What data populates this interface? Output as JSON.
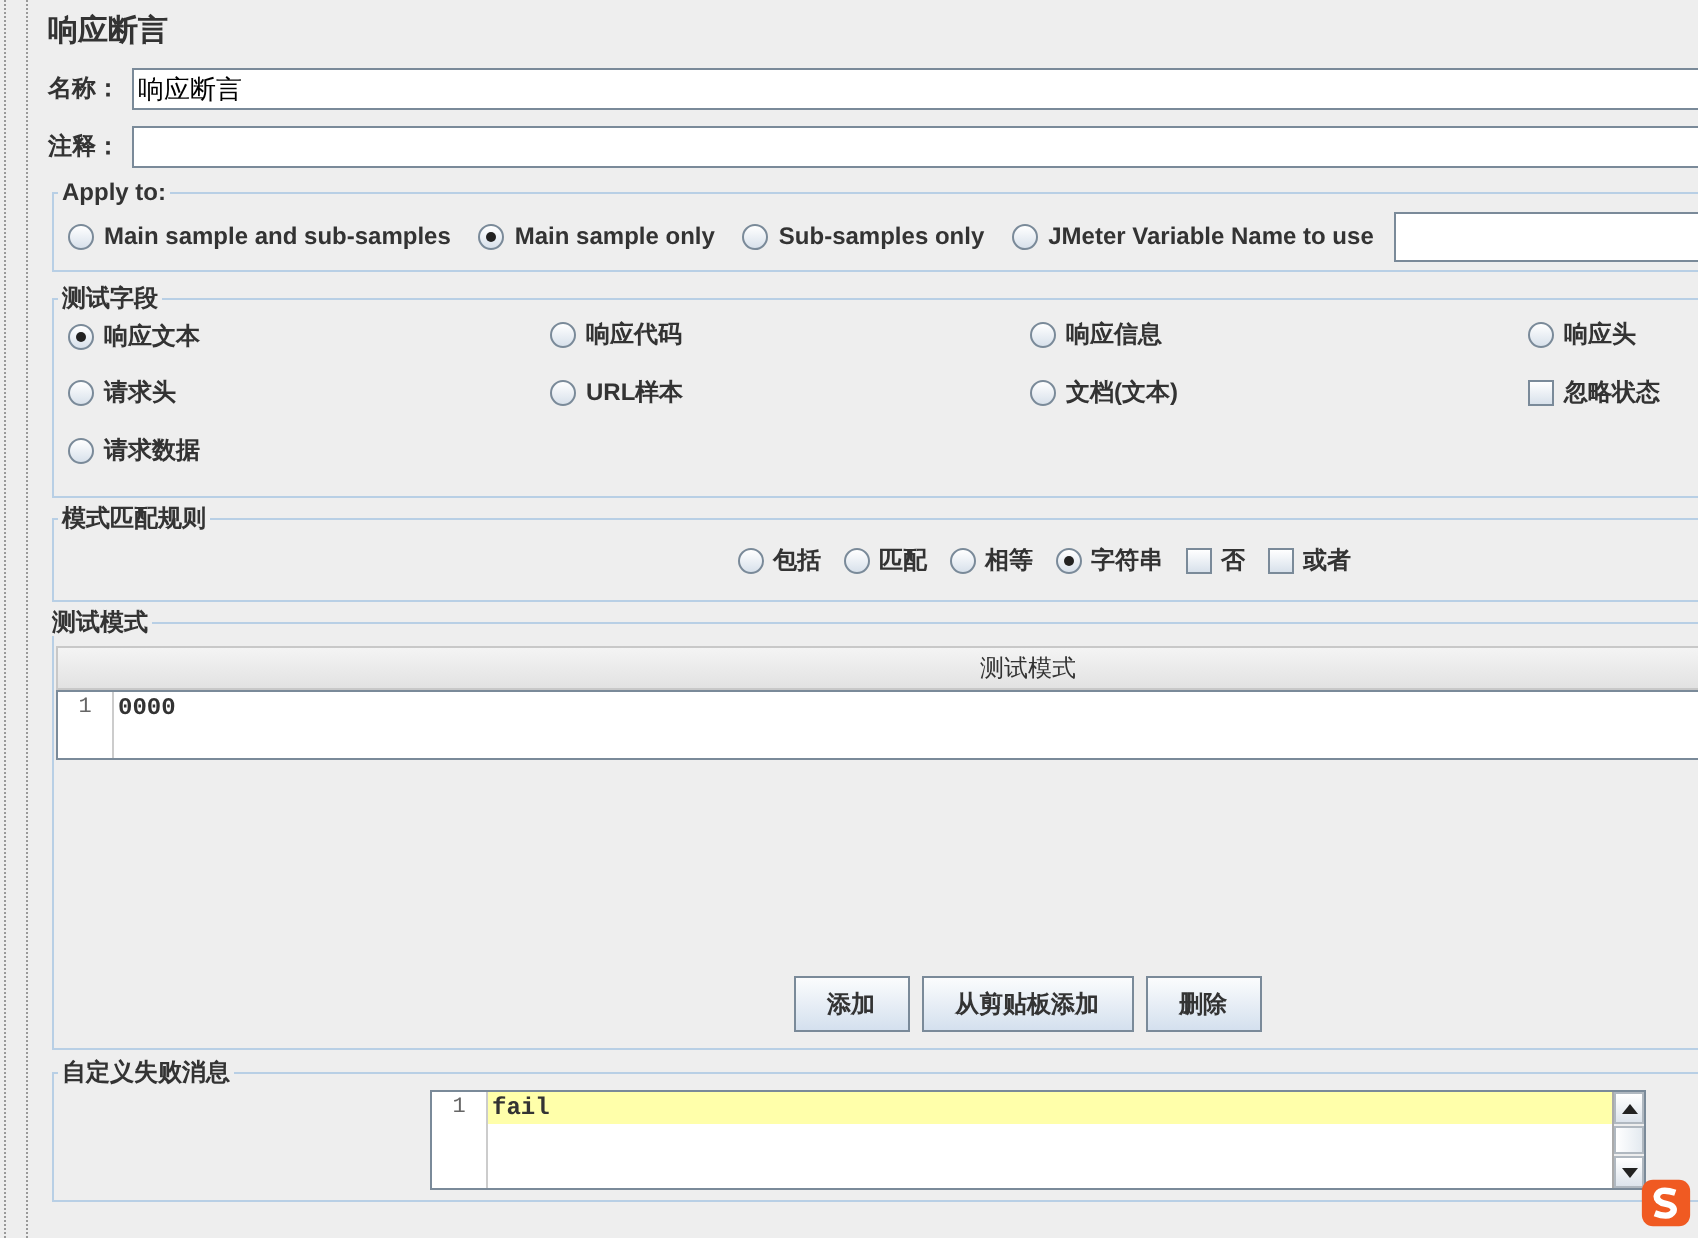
{
  "title": "响应断言",
  "name_field": {
    "label": "名称：",
    "value": "响应断言"
  },
  "comment_field": {
    "label": "注释："
  },
  "apply_to": {
    "title": "Apply to:",
    "options": [
      {
        "label": "Main sample and sub-samples",
        "selected": false
      },
      {
        "label": "Main sample only",
        "selected": true
      },
      {
        "label": "Sub-samples only",
        "selected": false
      },
      {
        "label": "JMeter Variable Name to use",
        "selected": false
      }
    ]
  },
  "test_field": {
    "title": "测试字段",
    "options": [
      {
        "kind": "radio",
        "label": "响应文本",
        "selected": true
      },
      {
        "kind": "radio",
        "label": "响应代码",
        "selected": false
      },
      {
        "kind": "radio",
        "label": "响应信息",
        "selected": false
      },
      {
        "kind": "radio",
        "label": "响应头",
        "selected": false
      },
      {
        "kind": "radio",
        "label": "请求头",
        "selected": false
      },
      {
        "kind": "radio",
        "label": "URL样本",
        "selected": false
      },
      {
        "kind": "radio",
        "label": "文档(文本)",
        "selected": false
      },
      {
        "kind": "checkbox",
        "label": "忽略状态",
        "checked": false
      },
      {
        "kind": "radio",
        "label": "请求数据",
        "selected": false
      }
    ]
  },
  "pattern_rule": {
    "title": "模式匹配规则",
    "options": [
      {
        "kind": "radio",
        "label": "包括",
        "selected": false
      },
      {
        "kind": "radio",
        "label": "匹配",
        "selected": false
      },
      {
        "kind": "radio",
        "label": "相等",
        "selected": false
      },
      {
        "kind": "radio",
        "label": "字符串",
        "selected": true
      },
      {
        "kind": "checkbox",
        "label": "否",
        "checked": false
      },
      {
        "kind": "checkbox",
        "label": "或者",
        "checked": false
      }
    ]
  },
  "test_patterns": {
    "title": "测试模式",
    "column": "测试模式",
    "rows": [
      {
        "line": "1",
        "text": "0000"
      }
    ],
    "buttons": [
      "添加",
      "从剪贴板添加",
      "删除"
    ]
  },
  "failure_message": {
    "title": "自定义失败消息",
    "lines": [
      {
        "line": "1",
        "text": "fail"
      }
    ]
  }
}
